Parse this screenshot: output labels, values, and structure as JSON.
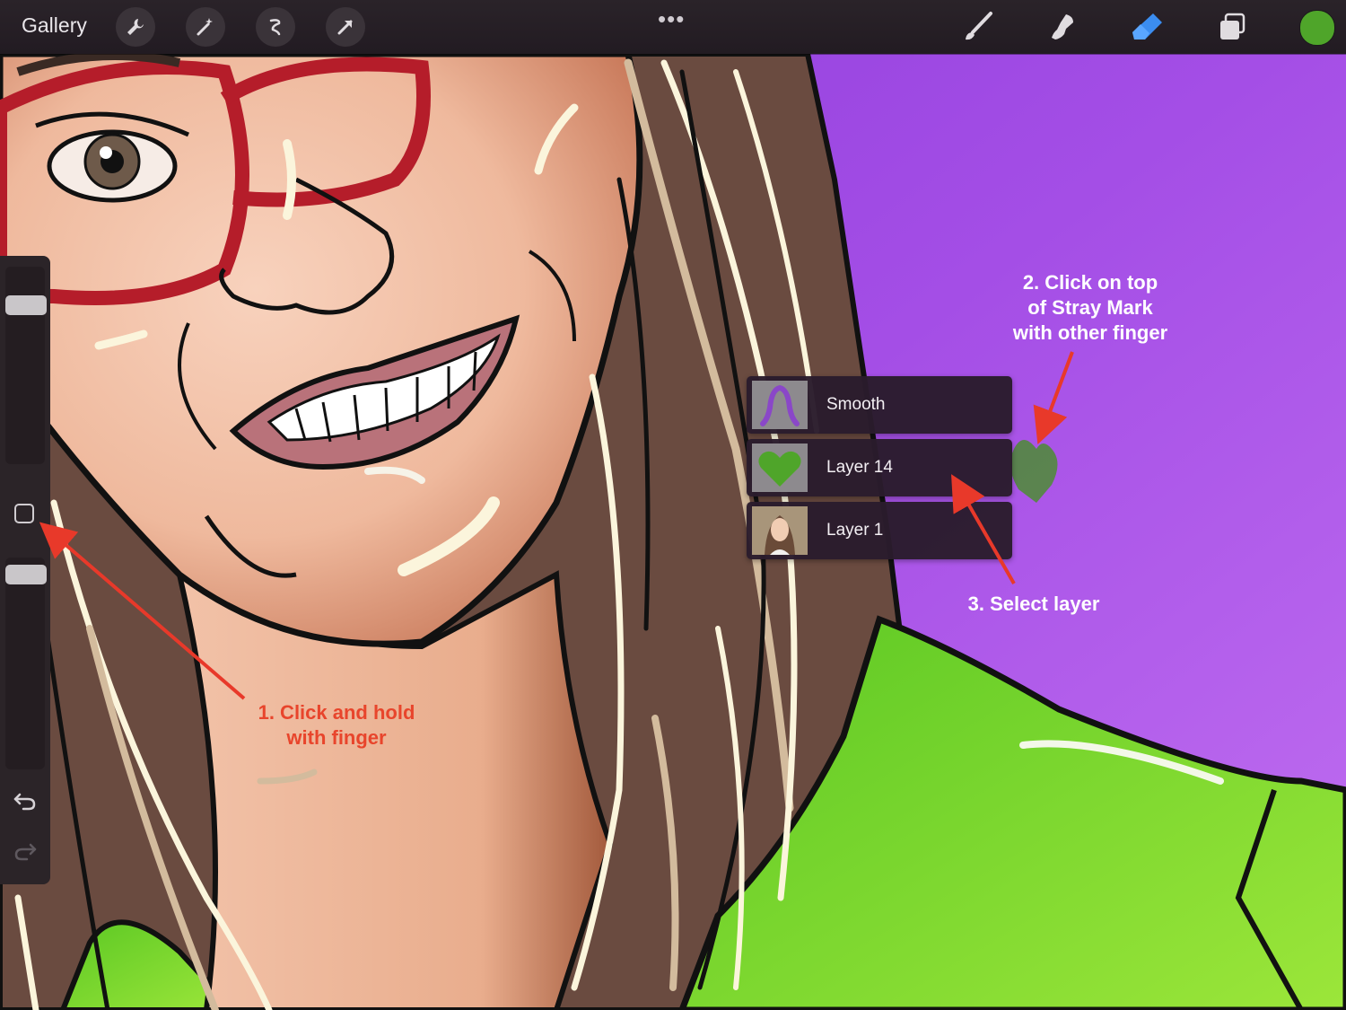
{
  "toolbar": {
    "gallery_label": "Gallery",
    "left_tools": [
      "wrench-icon",
      "magic-wand-icon",
      "selection-icon",
      "transform-arrow-icon"
    ],
    "more_label": "•••",
    "right_tools": [
      "brush-icon",
      "smudge-icon",
      "eraser-icon",
      "layers-icon"
    ],
    "current_color": "#4fa52a",
    "active_tool": "eraser"
  },
  "sidebar": {
    "brush_size_level": 0.85,
    "opacity_level": 1.0,
    "modify_button": "square-icon",
    "undo": "undo-icon",
    "redo": "redo-icon"
  },
  "layer_popup": {
    "items": [
      {
        "name": "Smooth",
        "thumb": "purple-hair-outline"
      },
      {
        "name": "Layer 14",
        "thumb": "green-heart"
      },
      {
        "name": "Layer 1",
        "thumb": "portrait-photo"
      }
    ]
  },
  "annotations": {
    "step1": [
      "1. Click and hold",
      "with finger"
    ],
    "step2": [
      "2. Click on top",
      "of Stray Mark",
      "with other finger"
    ],
    "step3": [
      "3. Select layer"
    ],
    "text_color_step1": "#e8452c",
    "text_color_other": "#ffffff",
    "arrow_color": "#e8392a"
  },
  "colors": {
    "background_purple": "#a44ee6",
    "shirt_green": "#6bcf2a",
    "glasses_red": "#b51d2a",
    "hair_brown": "#6a4b40"
  }
}
